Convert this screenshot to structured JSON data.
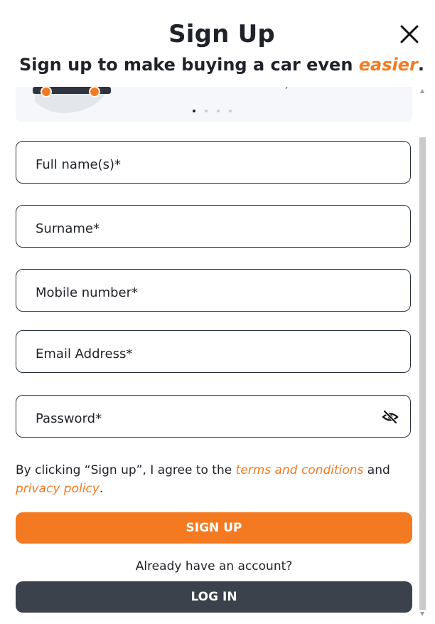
{
  "modal": {
    "title": "Sign Up",
    "subtitle_prefix": "Sign up to make buying a car even ",
    "subtitle_accent": "easier",
    "subtitle_suffix": "."
  },
  "carousel": {
    "slide_count": 4,
    "active_index": 0
  },
  "form": {
    "full_name_placeholder": "Full name(s)*",
    "surname_placeholder": "Surname*",
    "mobile_placeholder": "Mobile number*",
    "email_placeholder": "Email Address*",
    "password_placeholder": "Password*"
  },
  "terms": {
    "prefix": "By clicking “Sign up”, I agree to the ",
    "terms_link": "terms and conditions",
    "middle": " and ",
    "privacy_link": "privacy policy",
    "suffix": "."
  },
  "signup_button": "SIGN UP",
  "already_text": "Already have an account?",
  "login_button": "LOG IN",
  "icons": {
    "close": "close-icon",
    "password_toggle": "eye-slash-icon"
  },
  "colors": {
    "accent": "#f47a21",
    "dark_button": "#3c424c",
    "text": "#1f2329"
  }
}
